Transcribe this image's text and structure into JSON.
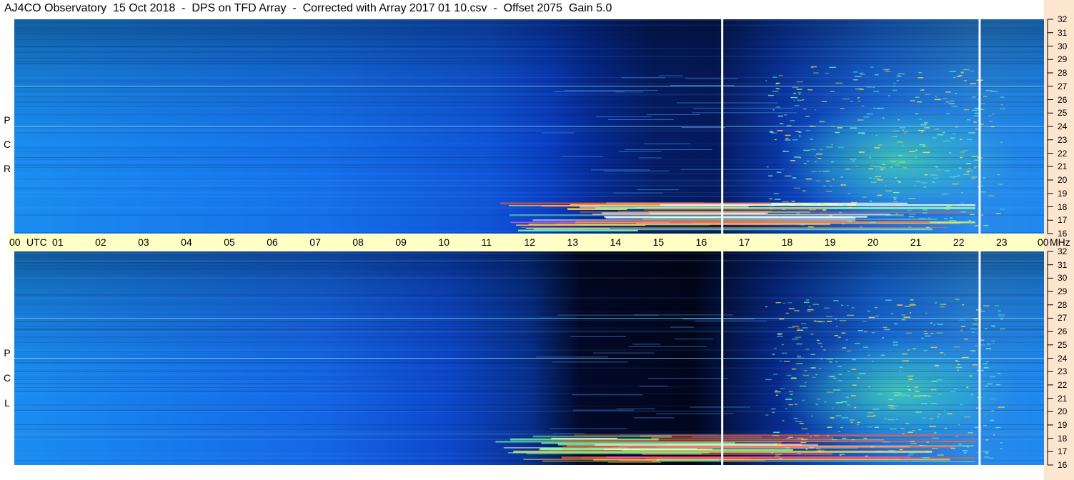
{
  "title": "AJ4CO Observatory  15 Oct 2018  -  DPS on TFD Array  -  Corrected with Array 2017 01 10.csv  -  Offset 2075  Gain 5.0",
  "panels": {
    "top": {
      "polarization": [
        "R",
        "C",
        "P"
      ]
    },
    "bottom": {
      "polarization": [
        "L",
        "C",
        "P"
      ]
    }
  },
  "utc_axis": {
    "labels": [
      "00",
      "01",
      "02",
      "03",
      "04",
      "05",
      "06",
      "07",
      "08",
      "09",
      "10",
      "11",
      "12",
      "13",
      "14",
      "15",
      "16",
      "17",
      "18",
      "19",
      "20",
      "21",
      "22",
      "23",
      "00"
    ],
    "utc_text": "UTC",
    "unit": "MHz"
  },
  "freq_axis": {
    "labels": [
      "32",
      "31",
      "30",
      "29",
      "28",
      "27",
      "26",
      "25",
      "24",
      "23",
      "22",
      "21",
      "20",
      "19",
      "18",
      "17",
      "16"
    ],
    "range": [
      16,
      32
    ],
    "unit": "MHz"
  },
  "colors": {
    "background_top": "#1464e6",
    "background_bottom": "#0a4fd2",
    "night_dark": "#000a26",
    "utc_bar": "#ffffc6",
    "right_strip": "#fde6cf"
  },
  "chart_data": {
    "type": "heatmap",
    "title": "AJ4CO Observatory  15 Oct 2018  -  DPS on TFD Array  -  Corrected with Array 2017 01 10.csv  -  Offset 2075  Gain 5.0",
    "x_axis": {
      "quantity": "UTC hour",
      "range": [
        0,
        24
      ]
    },
    "y_axis": {
      "quantity": "Frequency",
      "unit": "MHz",
      "range": [
        16,
        32
      ]
    },
    "panels": [
      "RCP",
      "LCP"
    ],
    "vertical_markers_utc": [
      16.5,
      22.5
    ]
  }
}
